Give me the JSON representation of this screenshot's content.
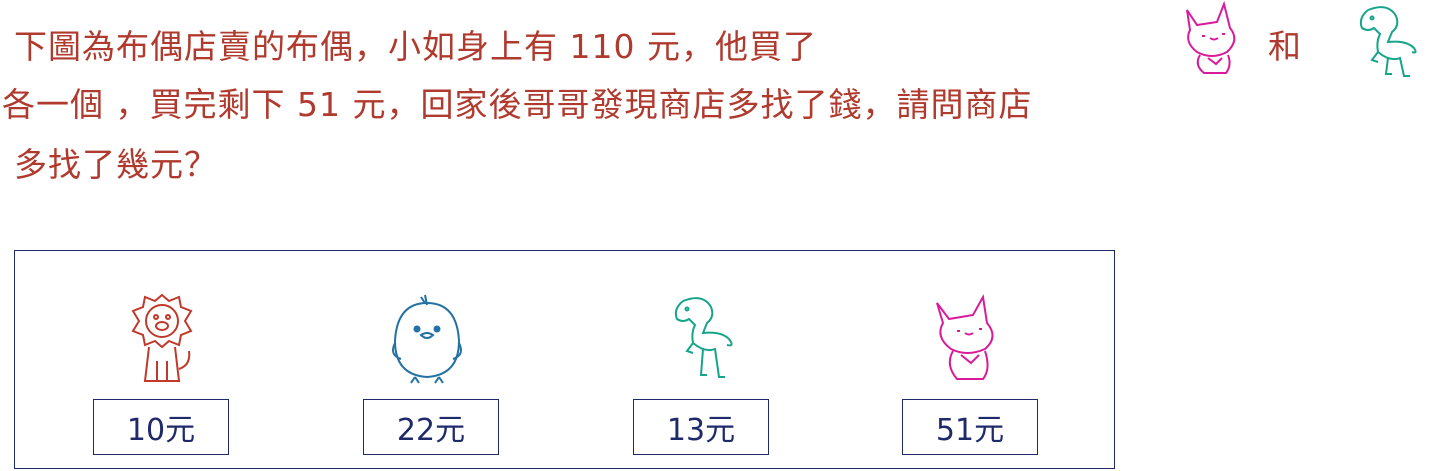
{
  "question": {
    "line1": "下圖為布偶店賣的布偶，小如身上有 110 元，他買了",
    "line1_he": "和",
    "line2": "各一個 ，買完剩下 51 元，回家後哥哥發現商店多找了錢，請問商店",
    "line3": "多找了幾元？"
  },
  "toys": [
    {
      "icon": "lion-icon",
      "price": "10元",
      "color": "#c0392b"
    },
    {
      "icon": "chick-icon",
      "price": "22元",
      "color": "#2471a3"
    },
    {
      "icon": "horse-icon",
      "price": "13元",
      "color": "#17a589"
    },
    {
      "icon": "fox-icon",
      "price": "51元",
      "color": "#d81b9a"
    }
  ]
}
